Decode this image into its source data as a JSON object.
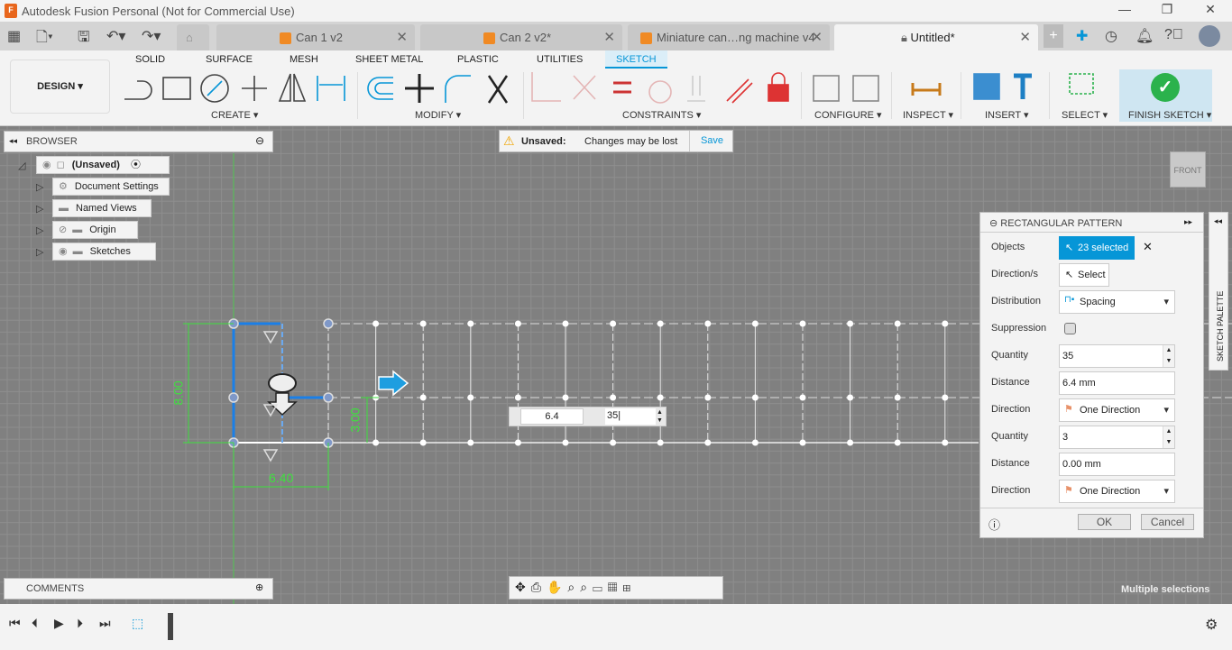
{
  "app": {
    "title": "Autodesk Fusion Personal (Not for Commercial Use)",
    "logo_letter": "F"
  },
  "doc_tabs": [
    {
      "label": "Can 1 v2"
    },
    {
      "label": "Can 2 v2*"
    },
    {
      "label": "Miniature can…ng machine v4"
    },
    {
      "label": "Untitled*",
      "active": true
    }
  ],
  "ribbon": {
    "workspace": "DESIGN",
    "tabs": [
      "SOLID",
      "SURFACE",
      "MESH",
      "SHEET METAL",
      "PLASTIC",
      "UTILITIES",
      "SKETCH"
    ],
    "active_tab": "SKETCH",
    "groups": [
      "CREATE",
      "MODIFY",
      "CONSTRAINTS",
      "CONFIGURE",
      "INSPECT",
      "INSERT",
      "SELECT",
      "FINISH SKETCH"
    ]
  },
  "browser": {
    "title": "BROWSER",
    "items": [
      {
        "label": "(Unsaved)"
      },
      {
        "label": "Document Settings"
      },
      {
        "label": "Named Views"
      },
      {
        "label": "Origin"
      },
      {
        "label": "Sketches"
      }
    ]
  },
  "unsaved": {
    "label": "Unsaved:",
    "message": "Changes may be lost",
    "save": "Save"
  },
  "viewcube": {
    "face": "FRONT"
  },
  "sketch": {
    "dim_width": "6.40",
    "dim_height": "8.00",
    "dim_offset": "3.00",
    "input_distance": "6.4",
    "input_quantity": "35"
  },
  "dialog": {
    "title": "RECTANGULAR PATTERN",
    "objects_label": "Objects",
    "objects_value": "23 selected",
    "directions_label": "Direction/s",
    "directions_value": "Select",
    "distribution_label": "Distribution",
    "distribution_value": "Spacing",
    "suppression_label": "Suppression",
    "suppression_checked": false,
    "quantity1_label": "Quantity",
    "quantity1_value": "35",
    "distance1_label": "Distance",
    "distance1_value": "6.4 mm",
    "direction1_label": "Direction",
    "direction1_value": "One Direction",
    "quantity2_label": "Quantity",
    "quantity2_value": "3",
    "distance2_label": "Distance",
    "distance2_value": "0.00 mm",
    "direction2_label": "Direction",
    "direction2_value": "One Direction",
    "ok": "OK",
    "cancel": "Cancel"
  },
  "sketch_palette": "SKETCH PALETTE",
  "comments": "COMMENTS",
  "status": "Multiple selections",
  "colors": {
    "accent": "#0696d7",
    "canvas": "#808080",
    "finish": "#2bb24c",
    "dimension": "#3ee03e"
  }
}
